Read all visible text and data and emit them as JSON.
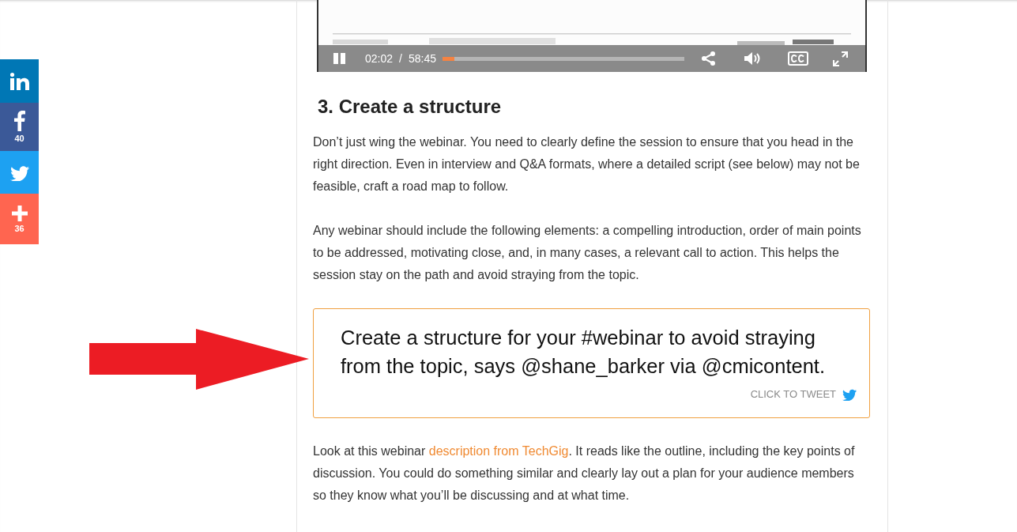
{
  "share_bar": [
    {
      "kind": "linkedin"
    },
    {
      "kind": "facebook",
      "count": "40"
    },
    {
      "kind": "twitter"
    },
    {
      "kind": "share",
      "count": "36"
    }
  ],
  "video": {
    "kind": "picture",
    "elapsed": "02:02",
    "separator": "/",
    "duration": "58:45",
    "level": 0.05
  },
  "heading": "3. Create a structure",
  "paragraphs": [
    [
      {
        "text": "Don’t just wing the webinar. You need to clearly define the session to ensure that you head in the right direction. Even in interview and Q&A formats, where a detailed script (see below) may not be feasible, craft a road map to follow."
      }
    ],
    [
      {
        "text": "Any webinar should include the following elements: a compelling introduction, order of main points to be addressed, motivating close, and, in many cases, a relevant call to action. This helps the session stay on the path and avoid straying from the topic."
      }
    ]
  ],
  "tweet_box": {
    "quote": "Create a structure for your #webinar to avoid straying from the topic, says @shane_barker via @cmicontent.",
    "cta": "CLICK TO TWEET"
  },
  "after_paragraphs": [
    [
      {
        "text": "Look at this webinar "
      },
      {
        "text": "description from TechGig",
        "link": true
      },
      {
        "text": ". It reads like the outline, including the key points of discussion. You could do something similar and clearly lay out a plan for your audience members so they know what you’ll be discussing and at what time."
      }
    ]
  ]
}
